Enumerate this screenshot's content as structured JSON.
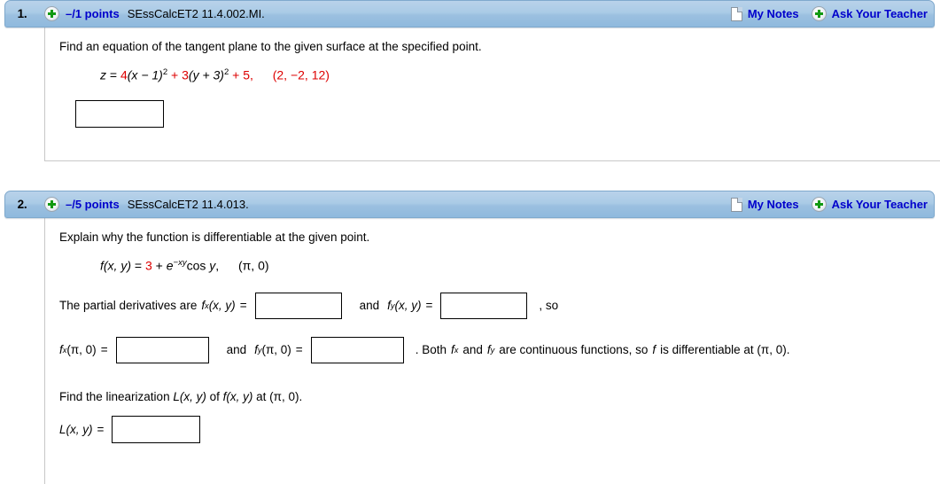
{
  "questions": [
    {
      "number": "1.",
      "points": "–/1 points",
      "code": "SEssCalcET2 11.4.002.MI.",
      "my_notes": "My Notes",
      "ask_teacher": "Ask Your Teacher",
      "prompt": "Find an equation of the tangent plane to the given surface at the specified point.",
      "equation": {
        "lhs": "z",
        "eq": "=",
        "coef1": "4",
        "paren1": "(x − 1)",
        "exp1": "2",
        "plus1": "+",
        "coef2": "3",
        "paren2": "(y + 3)",
        "exp2": "2",
        "plus2": "+",
        "const": "5",
        "comma": ",",
        "point": "(2, −2, 12)"
      },
      "answer_value": ""
    },
    {
      "number": "2.",
      "points": "–/5 points",
      "code": "SEssCalcET2 11.4.013.",
      "my_notes": "My Notes",
      "ask_teacher": "Ask Your Teacher",
      "prompt": "Explain why the function is differentiable at the given point.",
      "function": {
        "name": "f",
        "args": "(x, y)",
        "eq": "=",
        "const": "3",
        "plus": "+",
        "e": "e",
        "exponent": "−xy",
        "cos": "cos",
        "var": "y",
        "comma": ",",
        "point": "(π, 0)"
      },
      "partials_line": {
        "lead": "The partial derivatives are",
        "fx_name": "f",
        "fx_sub": "x",
        "fx_args": "(x, y)",
        "eq1": "=",
        "and": "and",
        "fy_name": "f",
        "fy_sub": "y",
        "fy_args": "(x, y)",
        "eq2": "=",
        "tail": ", so",
        "value_fx": "",
        "value_fy": ""
      },
      "evaluated_line": {
        "fx_name": "f",
        "fx_sub": "x",
        "fx_args": "(π, 0)",
        "eq1": "=",
        "and": "and",
        "fy_name": "f",
        "fy_sub": "y",
        "fy_args": "(π, 0)",
        "eq2": "=",
        "tail_pre": ".  Both",
        "tail_fx": "f",
        "tail_fx_sub": "x",
        "tail_mid": "and",
        "tail_fy": "f",
        "tail_fy_sub": "y",
        "tail_post": "are continuous functions, so",
        "tail_f": "f",
        "tail_end": "is differentiable at (π, 0).",
        "value_fx": "",
        "value_fy": ""
      },
      "linearization": {
        "prompt_pre": "Find the linearization",
        "L1": "L(x, y)",
        "prompt_mid": "of",
        "f1": "f(x, y)",
        "prompt_post": "at (π, 0).",
        "label": "L(x, y)",
        "eq": "=",
        "value": ""
      }
    }
  ],
  "colors": {
    "header_bar": "#a5c8e4",
    "link_blue": "#0000cc",
    "math_red": "#dd0000",
    "border_gray": "#c8c8c8"
  }
}
